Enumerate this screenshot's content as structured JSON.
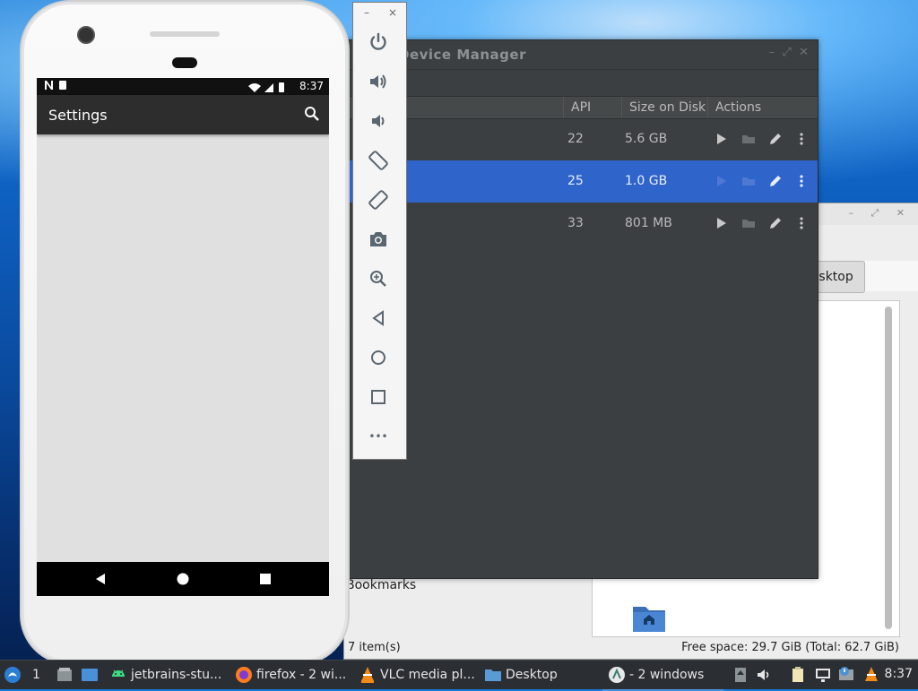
{
  "file_manager": {
    "path_button": "Desktop",
    "side_label": "Bookmarks",
    "status_items": "7 item(s)",
    "status_space": "Free space: 29.7 GiB (Total: 62.7 GiB)"
  },
  "device_manager": {
    "title": "Device Manager",
    "columns": {
      "api": "API",
      "size": "Size on Disk",
      "actions": "Actions"
    },
    "rows": [
      {
        "api": "22",
        "size": "5.6 GB"
      },
      {
        "api": "25",
        "size": "1.0 GB"
      },
      {
        "api": "33",
        "size": "801 MB"
      }
    ],
    "selected_row": 1
  },
  "phone": {
    "time": "8:37",
    "app_title": "Settings"
  },
  "emulator_toolbar": {
    "minimize_label": "–",
    "close_label": "×",
    "buttons": [
      "power-icon",
      "volume-up-icon",
      "volume-down-icon",
      "rotate-left-icon",
      "rotate-right-icon",
      "camera-icon",
      "zoom-icon",
      "back-icon",
      "home-icon",
      "overview-icon",
      "more-icon"
    ],
    "more_label": "•••"
  },
  "taskbar": {
    "workspace": "1",
    "apps": [
      {
        "label": "jetbrains-stu..."
      },
      {
        "label": "firefox - 2 wi..."
      },
      {
        "label": "VLC media pl..."
      },
      {
        "label": "Desktop"
      },
      {
        "label": "- 2 windows"
      }
    ],
    "time": "8:37"
  }
}
